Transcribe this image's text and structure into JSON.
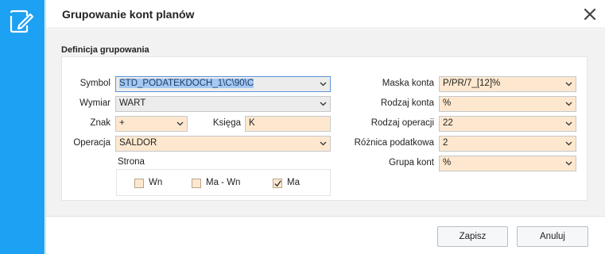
{
  "window": {
    "title": "Grupowanie kont planów"
  },
  "section": {
    "legend": "Definicja grupowania"
  },
  "left": {
    "symbol": {
      "label": "Symbol",
      "value": "STD_PODATEKDOCH_1\\C\\90\\C"
    },
    "wymiar": {
      "label": "Wymiar",
      "value": "WART"
    },
    "znak": {
      "label": "Znak",
      "value": "+"
    },
    "ksiega": {
      "label": "Księga",
      "value": "K"
    },
    "operacja": {
      "label": "Operacja",
      "value": "SALDOR"
    },
    "strona": {
      "label": "Strona",
      "options": [
        {
          "label": "Wn",
          "checked": false
        },
        {
          "label": "Ma - Wn",
          "checked": false
        },
        {
          "label": "Ma",
          "checked": true
        }
      ]
    }
  },
  "right": {
    "maska_konta": {
      "label": "Maska konta",
      "value": "P/PR/7_[12]%"
    },
    "rodzaj_konta": {
      "label": "Rodzaj konta",
      "value": "%"
    },
    "rodzaj_operacji": {
      "label": "Rodzaj operacji",
      "value": "22"
    },
    "roznica_podatkowa": {
      "label": "Różnica podatkowa",
      "value": "2"
    },
    "grupa_kont": {
      "label": "Grupa kont",
      "value": "%"
    }
  },
  "footer": {
    "save_label": "Zapisz",
    "cancel_label": "Anuluj"
  },
  "colors": {
    "sidebar": "#1da1f2",
    "field_bg": "#fde8cf",
    "field_gray": "#ececec",
    "selection": "#a4c8f0"
  },
  "icons": {
    "app": "document-edit-icon",
    "close": "close-icon",
    "dropdown": "chevron-down-icon",
    "check": "checkmark-icon"
  }
}
